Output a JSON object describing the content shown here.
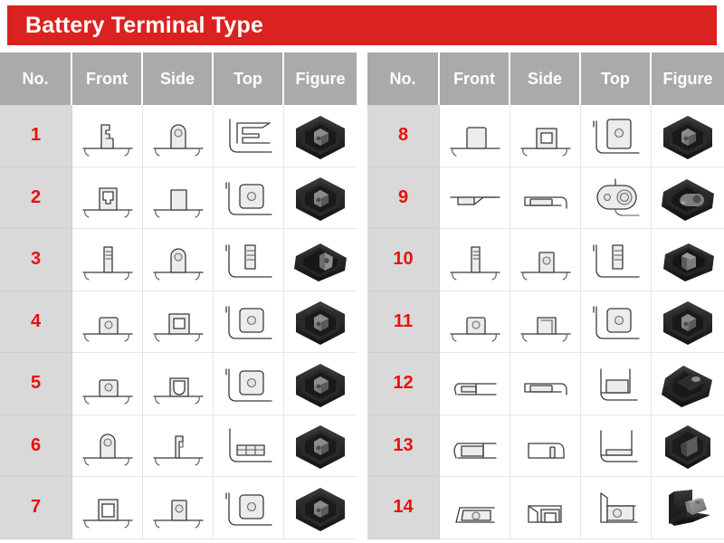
{
  "header": {
    "title": "Battery Terminal Type",
    "accent_color": "#da2220",
    "header_row_bg": "#aaaaaa",
    "no_cell_bg": "#d9d9d9",
    "number_color": "#e8100f"
  },
  "columns": [
    {
      "key": "no",
      "label": "No.",
      "icon": ""
    },
    {
      "key": "front",
      "label": "Front",
      "icon": "front-view-icon"
    },
    {
      "key": "side",
      "label": "Side",
      "icon": "side-view-icon"
    },
    {
      "key": "top",
      "label": "Top",
      "icon": "top-view-icon"
    },
    {
      "key": "figure",
      "label": "Figure",
      "icon": "3d-figure-icon"
    }
  ],
  "left_table": {
    "rows": [
      {
        "no": "1",
        "front": "stepped-post-front",
        "side": "round-top-lug-side",
        "top": "c-bracket-top",
        "figure": "hex-block-figure"
      },
      {
        "no": "2",
        "front": "socket-clip-front",
        "side": "plain-square-side",
        "top": "round-hole-top",
        "figure": "hex-block-figure"
      },
      {
        "no": "3",
        "front": "thin-ribbed-post-front",
        "side": "round-top-lug-side",
        "top": "ribbed-strip-top",
        "figure": "flat-pad-figure"
      },
      {
        "no": "4",
        "front": "hole-block-front",
        "side": "window-frame-side",
        "top": "round-hole-top",
        "figure": "hex-block-figure"
      },
      {
        "no": "5",
        "front": "hole-block-front",
        "side": "u-shape-side",
        "top": "round-hole-top",
        "figure": "hex-block-figure"
      },
      {
        "no": "6",
        "front": "round-top-lug-front",
        "side": "stepped-post-side",
        "top": "segmented-bar-top",
        "figure": "hex-block-figure"
      },
      {
        "no": "7",
        "front": "window-frame-front",
        "side": "hole-block-side",
        "top": "round-hole-top",
        "figure": "hex-block-figure"
      }
    ]
  },
  "right_table": {
    "rows": [
      {
        "no": "8",
        "front": "plain-square-front",
        "side": "window-frame-side",
        "top": "tall-hole-top",
        "figure": "hex-block-figure"
      },
      {
        "no": "9",
        "front": "flat-tab-front",
        "side": "flat-slot-side",
        "top": "two-hole-round-top",
        "figure": "oval-pad-figure"
      },
      {
        "no": "10",
        "front": "thin-ribbed-post-front",
        "side": "hole-block-side",
        "top": "ribbed-strip-top",
        "figure": "box-post-figure"
      },
      {
        "no": "11",
        "front": "hole-block-front",
        "side": "open-arch-side",
        "top": "round-hole-top",
        "figure": "hex-block-figure"
      },
      {
        "no": "12",
        "front": "flat-bar-front",
        "side": "flat-slot-side",
        "top": "corner-pad-top",
        "figure": "low-box-figure"
      },
      {
        "no": "13",
        "front": "boxed-bar-front",
        "side": "thin-blade-side",
        "top": "corner-strip-top",
        "figure": "cube-slot-figure"
      },
      {
        "no": "14",
        "front": "angled-hole-front",
        "side": "nested-box-side",
        "top": "angled-hole-top",
        "figure": "bracket-block-figure"
      }
    ]
  }
}
